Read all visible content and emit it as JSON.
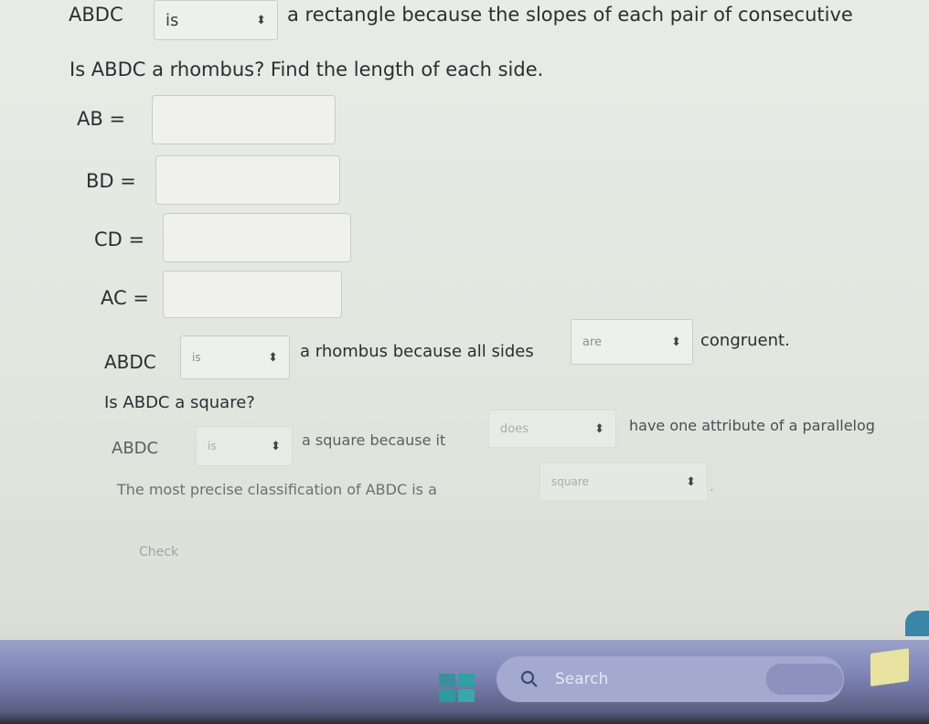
{
  "q1": {
    "name": "ABDC",
    "select": "is",
    "text": "a rectangle because the slopes of each pair of consecutive"
  },
  "q2": {
    "prompt": "Is ABDC a rhombus? Find the length of each side."
  },
  "sides": [
    {
      "label": "AB =",
      "value": ""
    },
    {
      "label": "BD =",
      "value": ""
    },
    {
      "label": "CD =",
      "value": ""
    },
    {
      "label": "AC =",
      "value": ""
    }
  ],
  "rhombus_stmt": {
    "name": "ABDC",
    "select1": "is",
    "middle": "a rhombus because all sides",
    "select2": "are",
    "end": "congruent."
  },
  "square_q": {
    "prompt": "Is ABDC a square?"
  },
  "square_stmt": {
    "name": "ABDC",
    "select1": "is",
    "middle": "a square because it",
    "select2": "does",
    "end": "have one attribute of a parallelog"
  },
  "classification": {
    "text": "The most precise classification of ABDC is a",
    "select": "square",
    "end": "."
  },
  "check_button": "Check",
  "taskbar": {
    "search": "Search"
  },
  "arrow_glyph": "⬍"
}
